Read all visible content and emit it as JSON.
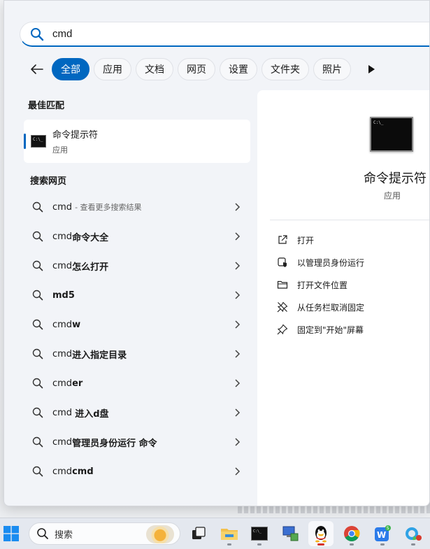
{
  "search": {
    "query": "cmd"
  },
  "filters": {
    "tabs": [
      "全部",
      "应用",
      "文档",
      "网页",
      "设置",
      "文件夹",
      "照片"
    ],
    "active_index": 0
  },
  "best_match": {
    "section_title": "最佳匹配",
    "name": "命令提示符",
    "type": "应用",
    "icon": "command-prompt-icon"
  },
  "web_search": {
    "section_title": "搜索网页",
    "items": [
      {
        "prefix": "cmd",
        "suffix": "",
        "hint": "- 查看更多搜索结果"
      },
      {
        "prefix": "cmd",
        "suffix": "命令大全",
        "hint": ""
      },
      {
        "prefix": "cmd",
        "suffix": "怎么打开",
        "hint": ""
      },
      {
        "prefix": "",
        "suffix": "md5",
        "hint": ""
      },
      {
        "prefix": "cmd",
        "suffix": "w",
        "hint": ""
      },
      {
        "prefix": "cmd",
        "suffix": "进入指定目录",
        "hint": ""
      },
      {
        "prefix": "cmd",
        "suffix": "er",
        "hint": ""
      },
      {
        "prefix": "cmd ",
        "suffix": "进入d盘",
        "hint": ""
      },
      {
        "prefix": "cmd",
        "suffix": "管理员身份运行 命令",
        "hint": ""
      },
      {
        "prefix": "cmd",
        "suffix": "cmd",
        "hint": ""
      }
    ]
  },
  "preview": {
    "name": "命令提示符",
    "type": "应用",
    "actions": [
      {
        "label": "打开",
        "icon": "open-external-icon"
      },
      {
        "label": "以管理员身份运行",
        "icon": "admin-shield-icon"
      },
      {
        "label": "打开文件位置",
        "icon": "folder-icon"
      },
      {
        "label": "从任务栏取消固定",
        "icon": "unpin-icon"
      },
      {
        "label": "固定到\"开始\"屏幕",
        "icon": "pin-icon"
      }
    ]
  },
  "taskbar": {
    "search_label": "搜索",
    "apps": [
      "file-explorer-icon",
      "command-prompt-icon",
      "network-computer-icon",
      "qq-icon",
      "chrome-icon",
      "wps-icon",
      "edge-icon"
    ]
  },
  "colors": {
    "accent": "#0067c0",
    "panel_bg": "#f2f4f8"
  }
}
